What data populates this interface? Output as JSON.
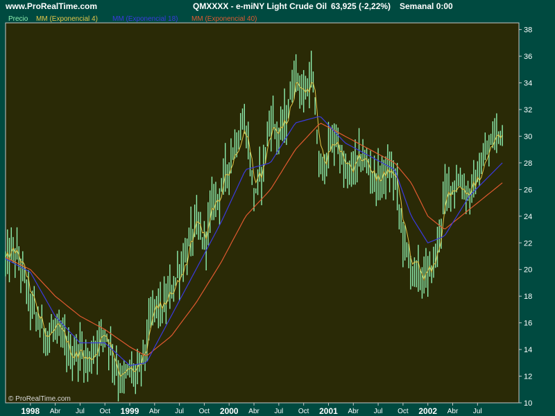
{
  "header": {
    "site": "www.ProRealTime.com",
    "symbol": "QMXXXX - e-miNY Light Crude Oil",
    "quote": "63,925 (-2,22%)",
    "period": "Semanal  0:00"
  },
  "watermark": "© ProRealTime.com",
  "colors": {
    "background": "#004a40",
    "plot_background": "#2a2a06",
    "price": "#8ef0b0",
    "ema4": "#e6c84a",
    "ema18": "#3a3ae0",
    "ema40": "#e05a30",
    "axis_text": "#ffffff"
  },
  "chart_data": {
    "type": "line",
    "legend_position": "top-left",
    "legend": [
      {
        "key": "price",
        "label": "Precio"
      },
      {
        "key": "ema4",
        "label": "MM (Exponencial 4)"
      },
      {
        "key": "ema18",
        "label": "MM (Exponencial 18)"
      },
      {
        "key": "ema40",
        "label": "MM (Exponencial 40)"
      }
    ],
    "y_axis": {
      "position": "right",
      "range": [
        10,
        38.5
      ],
      "ticks": [
        10,
        12,
        14,
        16,
        18,
        20,
        22,
        24,
        26,
        28,
        30,
        32,
        34,
        36,
        38
      ]
    },
    "x_axis": {
      "range": [
        "1997-10",
        "2002-12"
      ],
      "ticks": [
        {
          "label": "1998",
          "date": "1998-01",
          "year": true
        },
        {
          "label": "Abr",
          "date": "1998-04"
        },
        {
          "label": "Jul",
          "date": "1998-07"
        },
        {
          "label": "Oct",
          "date": "1998-10"
        },
        {
          "label": "1999",
          "date": "1999-01",
          "year": true
        },
        {
          "label": "Abr",
          "date": "1999-04"
        },
        {
          "label": "Jul",
          "date": "1999-07"
        },
        {
          "label": "Oct",
          "date": "1999-10"
        },
        {
          "label": "2000",
          "date": "2000-01",
          "year": true
        },
        {
          "label": "Abr",
          "date": "2000-04"
        },
        {
          "label": "Jul",
          "date": "2000-07"
        },
        {
          "label": "Oct",
          "date": "2000-10"
        },
        {
          "label": "2001",
          "date": "2001-01",
          "year": true
        },
        {
          "label": "Abr",
          "date": "2001-04"
        },
        {
          "label": "Jul",
          "date": "2001-07"
        },
        {
          "label": "Oct",
          "date": "2001-10"
        },
        {
          "label": "2002",
          "date": "2002-01",
          "year": true
        },
        {
          "label": "Abr",
          "date": "2002-04"
        },
        {
          "label": "Jul",
          "date": "2002-07"
        }
      ]
    },
    "price_keypoints": [
      [
        "1997-10",
        20.5
      ],
      [
        "1997-11",
        21.5
      ],
      [
        "1997-12",
        20.0
      ],
      [
        "1998-01",
        17.5
      ],
      [
        "1998-02",
        16.0
      ],
      [
        "1998-03",
        15.0
      ],
      [
        "1998-04",
        15.5
      ],
      [
        "1998-05",
        14.5
      ],
      [
        "1998-06",
        13.5
      ],
      [
        "1998-07",
        14.0
      ],
      [
        "1998-08",
        13.0
      ],
      [
        "1998-09",
        14.5
      ],
      [
        "1998-10",
        15.5
      ],
      [
        "1998-11",
        13.5
      ],
      [
        "1998-12",
        11.5
      ],
      [
        "1999-01",
        12.5
      ],
      [
        "1999-02",
        12.0
      ],
      [
        "1999-03",
        14.5
      ],
      [
        "1999-04",
        17.5
      ],
      [
        "1999-05",
        17.0
      ],
      [
        "1999-06",
        18.5
      ],
      [
        "1999-07",
        20.0
      ],
      [
        "1999-08",
        21.5
      ],
      [
        "1999-09",
        23.5
      ],
      [
        "1999-10",
        22.0
      ],
      [
        "1999-11",
        25.0
      ],
      [
        "1999-12",
        26.0
      ],
      [
        "2000-01",
        28.0
      ],
      [
        "2000-02",
        30.0
      ],
      [
        "2000-03",
        31.0
      ],
      [
        "2000-04",
        25.5
      ],
      [
        "2000-05",
        27.5
      ],
      [
        "2000-06",
        31.5
      ],
      [
        "2000-07",
        30.0
      ],
      [
        "2000-08",
        31.5
      ],
      [
        "2000-09",
        35.0
      ],
      [
        "2000-10",
        33.0
      ],
      [
        "2000-11",
        34.5
      ],
      [
        "2000-12",
        27.0
      ],
      [
        "2001-01",
        29.0
      ],
      [
        "2001-02",
        30.0
      ],
      [
        "2001-03",
        27.0
      ],
      [
        "2001-04",
        27.5
      ],
      [
        "2001-05",
        28.5
      ],
      [
        "2001-06",
        27.5
      ],
      [
        "2001-07",
        26.5
      ],
      [
        "2001-08",
        27.5
      ],
      [
        "2001-09",
        27.0
      ],
      [
        "2001-10",
        22.5
      ],
      [
        "2001-11",
        20.0
      ],
      [
        "2001-12",
        19.5
      ],
      [
        "2002-01",
        19.5
      ],
      [
        "2002-02",
        21.0
      ],
      [
        "2002-03",
        25.5
      ],
      [
        "2002-04",
        26.5
      ],
      [
        "2002-05",
        26.5
      ],
      [
        "2002-06",
        25.5
      ],
      [
        "2002-07",
        27.0
      ],
      [
        "2002-08",
        28.5
      ],
      [
        "2002-09",
        30.0
      ],
      [
        "2002-10",
        30.5
      ]
    ],
    "ema18_keypoints": [
      [
        "1997-10",
        20.8
      ],
      [
        "1998-01",
        19.8
      ],
      [
        "1998-04",
        16.5
      ],
      [
        "1998-07",
        14.5
      ],
      [
        "1998-10",
        14.5
      ],
      [
        "1999-01",
        12.8
      ],
      [
        "1999-03",
        13.0
      ],
      [
        "1999-06",
        16.5
      ],
      [
        "1999-09",
        20.0
      ],
      [
        "1999-12",
        23.5
      ],
      [
        "2000-03",
        27.5
      ],
      [
        "2000-06",
        28.0
      ],
      [
        "2000-09",
        31.0
      ],
      [
        "2000-12",
        31.5
      ],
      [
        "2001-03",
        29.5
      ],
      [
        "2001-06",
        28.5
      ],
      [
        "2001-09",
        27.5
      ],
      [
        "2001-11",
        24.0
      ],
      [
        "2002-01",
        22.0
      ],
      [
        "2002-03",
        22.5
      ],
      [
        "2002-06",
        25.5
      ],
      [
        "2002-10",
        28.0
      ]
    ],
    "ema40_keypoints": [
      [
        "1997-10",
        20.9
      ],
      [
        "1998-01",
        20.0
      ],
      [
        "1998-04",
        18.0
      ],
      [
        "1998-07",
        16.5
      ],
      [
        "1998-10",
        15.5
      ],
      [
        "1999-01",
        14.2
      ],
      [
        "1999-03",
        13.5
      ],
      [
        "1999-06",
        15.0
      ],
      [
        "1999-09",
        17.5
      ],
      [
        "1999-12",
        20.5
      ],
      [
        "2000-03",
        24.0
      ],
      [
        "2000-06",
        26.0
      ],
      [
        "2000-09",
        29.0
      ],
      [
        "2000-12",
        31.0
      ],
      [
        "2001-03",
        30.0
      ],
      [
        "2001-06",
        29.0
      ],
      [
        "2001-09",
        28.0
      ],
      [
        "2001-11",
        26.5
      ],
      [
        "2002-01",
        24.0
      ],
      [
        "2002-03",
        23.0
      ],
      [
        "2002-06",
        24.5
      ],
      [
        "2002-10",
        26.5
      ]
    ]
  }
}
